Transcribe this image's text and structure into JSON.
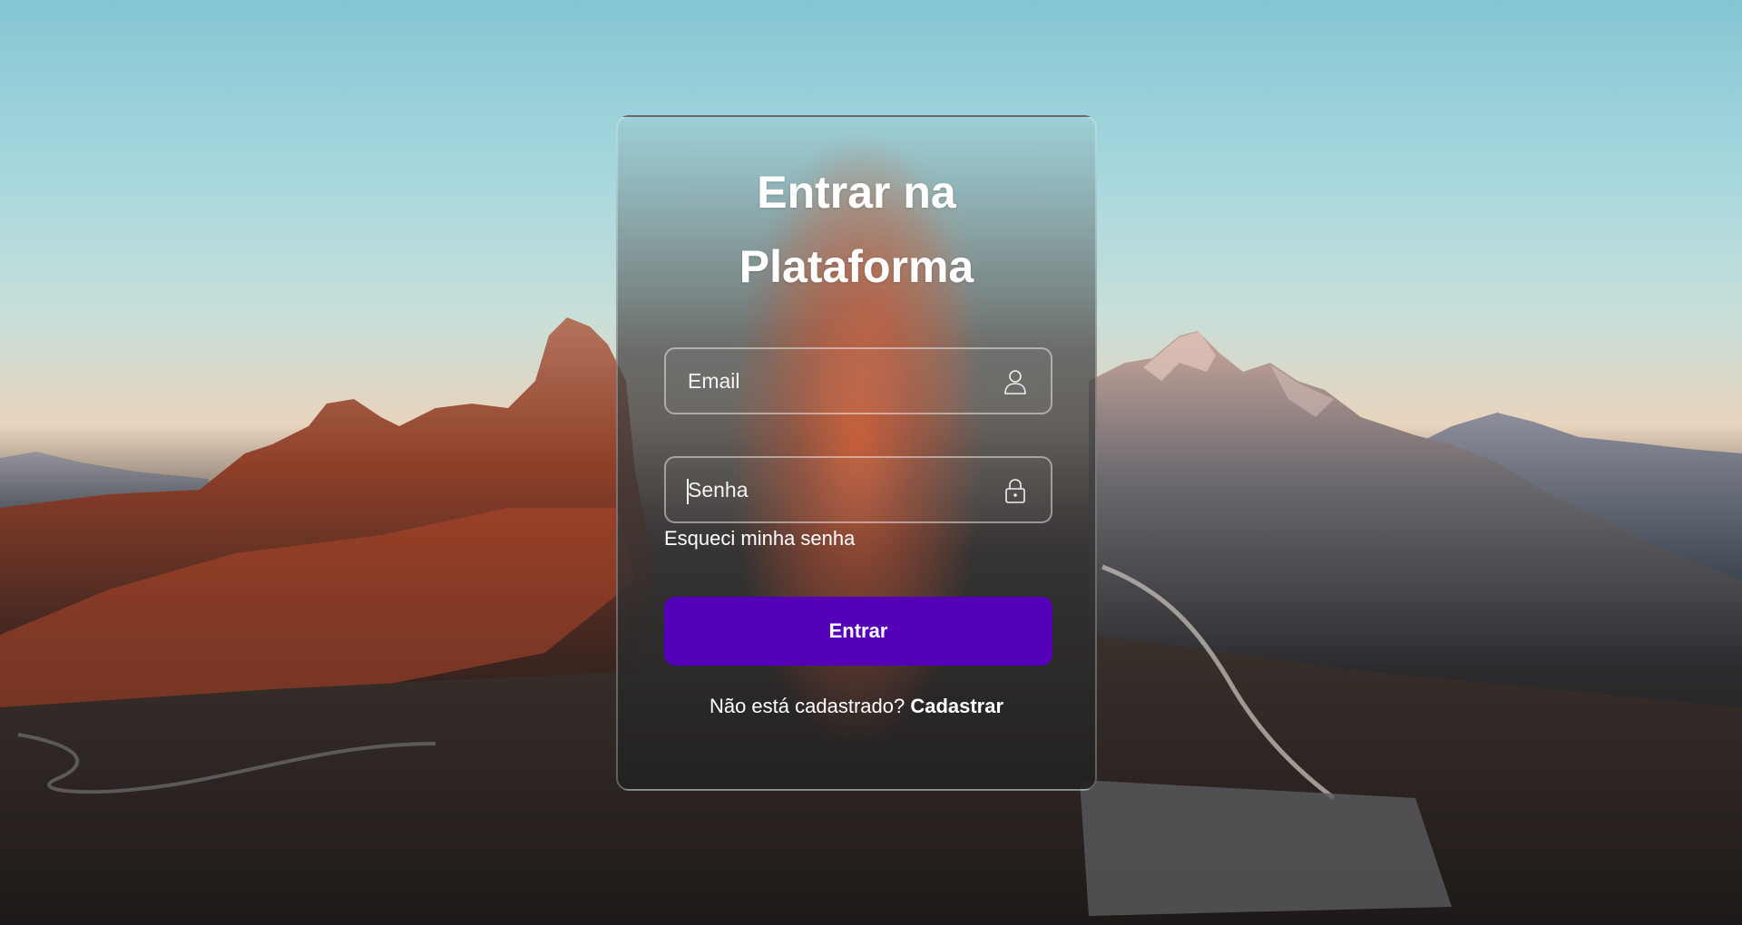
{
  "login": {
    "title_line1": "Entrar na",
    "title_line2": "Plataforma",
    "email": {
      "placeholder": "Email",
      "value": "",
      "icon": "user-icon"
    },
    "password": {
      "placeholder": "Senha",
      "value": "",
      "icon": "lock-icon"
    },
    "forgot_link": "Esqueci minha senha",
    "submit_label": "Entrar",
    "signup_prompt": "Não está cadastrado?",
    "signup_link": "Cadastrar"
  },
  "colors": {
    "button": "#5500b8",
    "text": "#ffffff"
  }
}
